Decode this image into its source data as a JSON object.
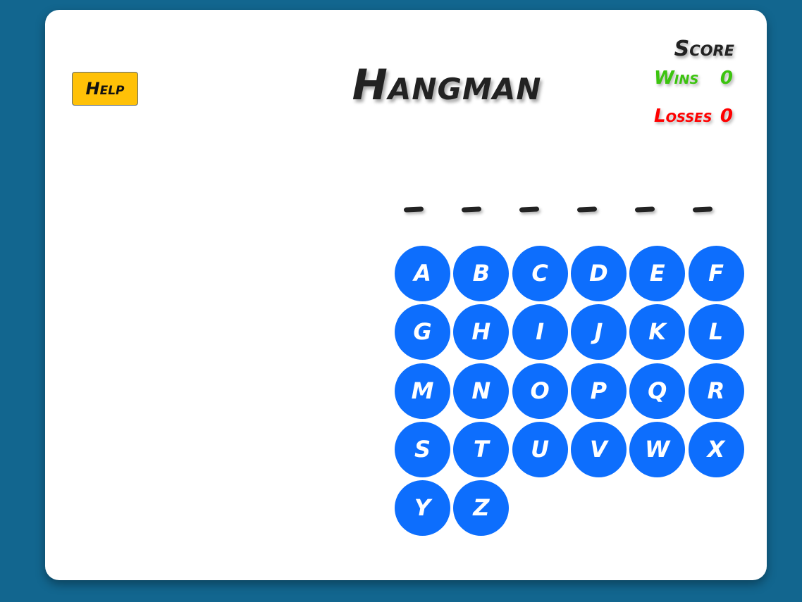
{
  "header": {
    "help_label": "Help",
    "title": "Hangman"
  },
  "score": {
    "label": "Score",
    "wins_label": "Wins",
    "wins_value": "0",
    "losses_label": "Losses",
    "losses_value": "0",
    "wins_color": "#3cc40f",
    "losses_color": "#ff0000"
  },
  "word": {
    "blanks": [
      "_",
      "_",
      "_",
      "_",
      "_",
      "_"
    ]
  },
  "keyboard": {
    "letters": [
      "A",
      "B",
      "C",
      "D",
      "E",
      "F",
      "G",
      "H",
      "I",
      "J",
      "K",
      "L",
      "M",
      "N",
      "O",
      "P",
      "Q",
      "R",
      "S",
      "T",
      "U",
      "V",
      "W",
      "X",
      "Y",
      "Z"
    ],
    "button_color": "#0d6efd"
  },
  "theme": {
    "background": "#12668f",
    "help_button_color": "#ffc107"
  }
}
